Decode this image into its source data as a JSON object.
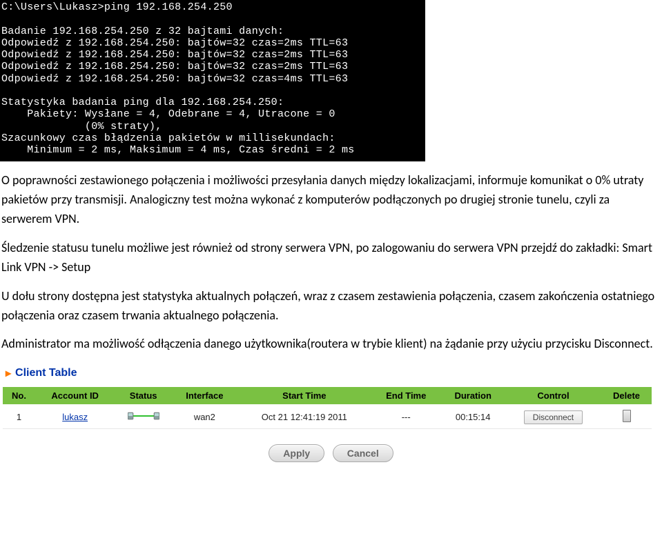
{
  "terminal": {
    "line1": "C:\\Users\\Lukasz>ping 192.168.254.250",
    "line2": "",
    "line3": "Badanie 192.168.254.250 z 32 bajtami danych:",
    "line4": "Odpowiedź z 192.168.254.250: bajtów=32 czas=2ms TTL=63",
    "line5": "Odpowiedź z 192.168.254.250: bajtów=32 czas=2ms TTL=63",
    "line6": "Odpowiedź z 192.168.254.250: bajtów=32 czas=2ms TTL=63",
    "line7": "Odpowiedź z 192.168.254.250: bajtów=32 czas=4ms TTL=63",
    "line8": "",
    "line9": "Statystyka badania ping dla 192.168.254.250:",
    "line10": "    Pakiety: Wysłane = 4, Odebrane = 4, Utracone = 0",
    "line11": "             (0% straty),",
    "line12": "Szacunkowy czas błądzenia pakietów w millisekundach:",
    "line13": "    Minimum = 2 ms, Maksimum = 4 ms, Czas średni = 2 ms"
  },
  "paragraphs": {
    "p1": "O poprawności zestawionego połączenia i możliwości przesyłania danych między lokalizacjami, informuje komunikat o 0% utraty pakietów przy transmisji. Analogiczny test można wykonać z komputerów podłączonych po drugiej stronie tunelu, czyli za serwerem VPN.",
    "p2": "Śledzenie statusu tunelu możliwe jest również od strony serwera VPN, po zalogowaniu do serwera VPN przejdź do zakładki: Smart Link VPN -> Setup",
    "p3": "U dołu strony dostępna jest statystyka aktualnych połączeń, wraz z czasem zestawienia połączenia, czasem zakończenia ostatniego połączenia oraz czasem trwania aktualnego połączenia.",
    "p4": "Administrator ma możliwość odłączenia danego użytkownika(routera w trybie klient) na żądanie przy użyciu przycisku Disconnect."
  },
  "section": {
    "title": "Client Table"
  },
  "table": {
    "headers": {
      "no": "No.",
      "account": "Account ID",
      "status": "Status",
      "interface": "Interface",
      "start": "Start Time",
      "end": "End Time",
      "duration": "Duration",
      "control": "Control",
      "delete": "Delete"
    },
    "row": {
      "no": "1",
      "account": "lukasz",
      "interface": "wan2",
      "start": "Oct 21 12:41:19 2011",
      "end": "---",
      "duration": "00:15:14",
      "control": "Disconnect"
    }
  },
  "buttons": {
    "apply": "Apply",
    "cancel": "Cancel"
  }
}
